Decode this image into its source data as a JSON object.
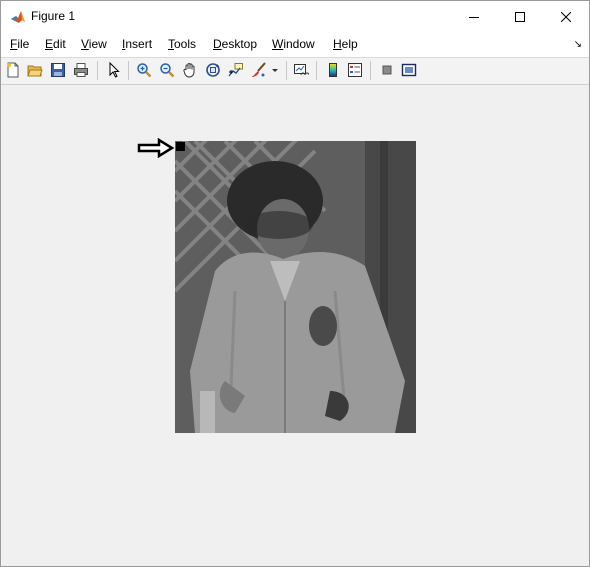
{
  "window": {
    "title": "Figure 1"
  },
  "menu": {
    "items": [
      {
        "label": "File",
        "key": "F",
        "rest": "ile",
        "name": "menu-file"
      },
      {
        "label": "Edit",
        "key": "E",
        "rest": "dit",
        "name": "menu-edit"
      },
      {
        "label": "View",
        "key": "V",
        "rest": "iew",
        "name": "menu-view"
      },
      {
        "label": "Insert",
        "key": "I",
        "rest": "nsert",
        "name": "menu-insert"
      },
      {
        "label": "Tools",
        "key": "T",
        "rest": "ools",
        "name": "menu-tools"
      },
      {
        "label": "Desktop",
        "key": "D",
        "rest": "esktop",
        "name": "menu-desktop"
      },
      {
        "label": "Window",
        "key": "W",
        "rest": "indow",
        "name": "menu-window"
      },
      {
        "label": "Help",
        "key": "H",
        "rest": "elp",
        "name": "menu-help"
      }
    ]
  },
  "toolbar": {
    "icons": [
      "new-figure-icon",
      "open-file-icon",
      "save-icon",
      "print-icon",
      "select-pointer-icon",
      "zoom-in-icon",
      "zoom-out-icon",
      "pan-hand-icon",
      "rotate-3d-icon",
      "data-cursor-icon",
      "brush-icon",
      "link-plot-icon",
      "colorbar-icon",
      "legend-icon",
      "hide-plot-tools-icon",
      "show-plot-tools-icon"
    ]
  },
  "figure": {
    "image_description_color": "#6e6e6e",
    "annotation_arrow_color": "#000000",
    "marker_color": "#000000"
  }
}
